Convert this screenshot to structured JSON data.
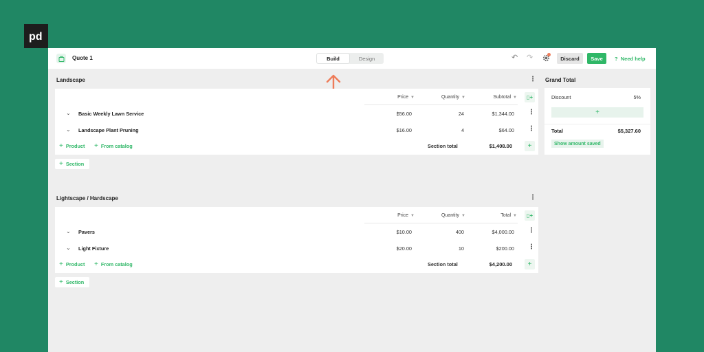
{
  "brand": {
    "logo_text": "pd",
    "accent": "#2fb767",
    "background": "#208764",
    "arrow_color": "#ee7b58"
  },
  "header": {
    "doc_title": "Quote 1",
    "tabs": [
      {
        "label": "Build",
        "active": true
      },
      {
        "label": "Design",
        "active": false
      }
    ],
    "discard_label": "Discard",
    "save_label": "Save",
    "help_label": "Need help"
  },
  "sections": [
    {
      "title": "Landscape",
      "columns": {
        "price": "Price",
        "quantity": "Quantity",
        "total": "Subtotal"
      },
      "rows": [
        {
          "name": "Basic Weekly Lawn Service",
          "price": "$56.00",
          "quantity": "24",
          "total": "$1,344.00"
        },
        {
          "name": "Landscape Plant Pruning",
          "price": "$16.00",
          "quantity": "4",
          "total": "$64.00"
        }
      ],
      "add_product": "Product",
      "add_catalog": "From catalog",
      "total_label": "Section total",
      "total_value": "$1,408.00",
      "add_section": "Section"
    },
    {
      "title": "Lightscape / Hardscape",
      "columns": {
        "price": "Price",
        "quantity": "Quantity",
        "total": "Total"
      },
      "rows": [
        {
          "name": "Pavers",
          "price": "$10.00",
          "quantity": "400",
          "total": "$4,000.00"
        },
        {
          "name": "Light Fixture",
          "price": "$20.00",
          "quantity": "10",
          "total": "$200.00"
        }
      ],
      "add_product": "Product",
      "add_catalog": "From catalog",
      "total_label": "Section total",
      "total_value": "$4,200.00",
      "add_section": "Section"
    }
  ],
  "grand_total": {
    "title": "Grand Total",
    "discount_label": "Discount",
    "discount_value": "5%",
    "total_label": "Total",
    "total_value": "$5,327.60",
    "show_saved_label": "Show amount saved"
  }
}
